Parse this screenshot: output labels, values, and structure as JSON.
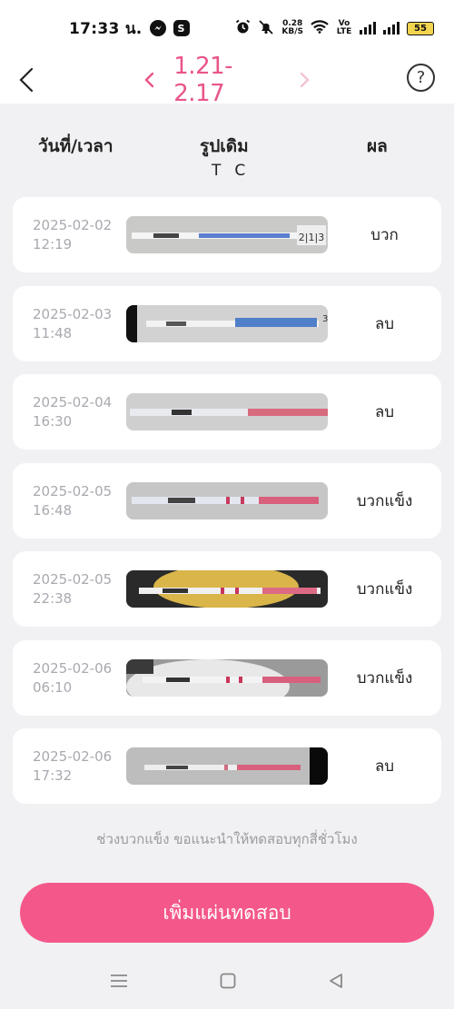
{
  "status_bar": {
    "time": "17:33 น.",
    "speed_value": "0.28",
    "speed_unit": "KB/S",
    "volte": "Vo LTE",
    "battery": "55",
    "icons": [
      "messenger-icon",
      "s-app-icon",
      "alarm-icon",
      "mute-icon",
      "wifi-icon",
      "signal-icon",
      "battery-icon"
    ]
  },
  "header": {
    "date_range": "1.21-2.17",
    "accent_color": "#e9548a",
    "help_label": "?"
  },
  "columns": {
    "date": "วันที่/เวลา",
    "image": "รูปเดิม",
    "tc": "TC",
    "result": "ผล"
  },
  "records": [
    {
      "date": "2025-02-02",
      "time": "12:19",
      "result": "บวก",
      "strip_marks": "2|1|3"
    },
    {
      "date": "2025-02-03",
      "time": "11:48",
      "result": "ลบ",
      "strip_marks": "3"
    },
    {
      "date": "2025-02-04",
      "time": "16:30",
      "result": "ลบ",
      "strip_marks": ""
    },
    {
      "date": "2025-02-05",
      "time": "16:48",
      "result": "บวกแข็ง",
      "strip_marks": ""
    },
    {
      "date": "2025-02-05",
      "time": "22:38",
      "result": "บวกแข็ง",
      "strip_marks": ""
    },
    {
      "date": "2025-02-06",
      "time": "06:10",
      "result": "บวกแข็ง",
      "strip_marks": ""
    },
    {
      "date": "2025-02-06",
      "time": "17:32",
      "result": "ลบ",
      "strip_marks": ""
    }
  ],
  "note": "ช่วงบวกแข็ง ขอแนะนำให้ทดสอบทุกสี่ชั่วโมง",
  "add_button": {
    "label": "เพิ่มแผ่นทดสอบ",
    "color": "#f4588a"
  },
  "nav_bar": {
    "icons": [
      "menu-icon",
      "home-icon",
      "back-triangle-icon"
    ]
  }
}
